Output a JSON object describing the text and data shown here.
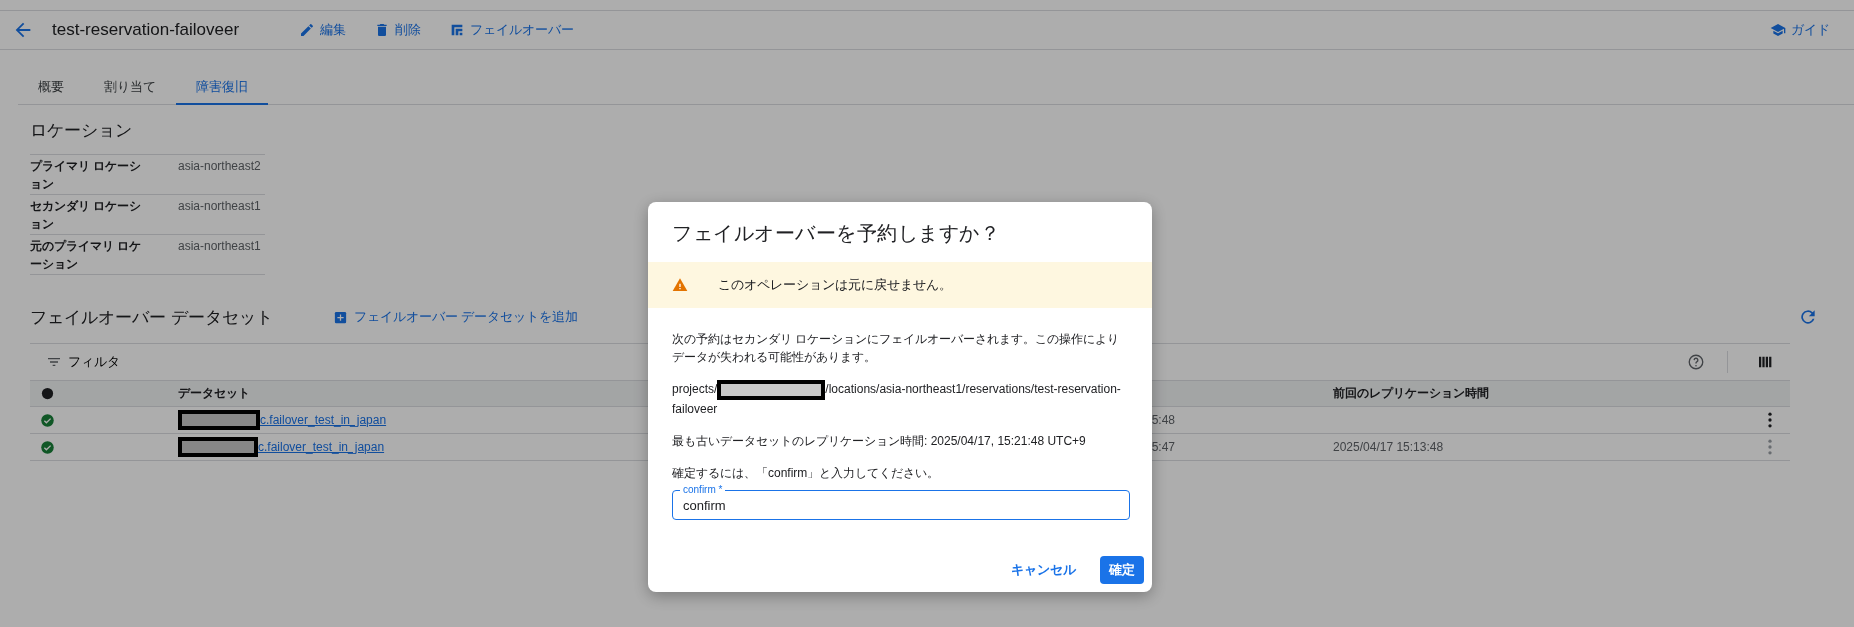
{
  "header": {
    "title": "test-reservation-failoveer",
    "actions": [
      {
        "kind": "edit",
        "label": "編集"
      },
      {
        "kind": "delete",
        "label": "削除"
      },
      {
        "kind": "failover",
        "label": "フェイルオーバー"
      }
    ],
    "guide": "ガイド"
  },
  "tabs": [
    {
      "label": "概要",
      "selected": false
    },
    {
      "label": "割り当て",
      "selected": false
    },
    {
      "label": "障害復旧",
      "selected": true
    }
  ],
  "location": {
    "heading": "ロケーション",
    "rows": [
      {
        "label": "プライマリ ロケーション",
        "value": "asia-northeast2"
      },
      {
        "label": "セカンダリ ロケーション",
        "value": "asia-northeast1"
      },
      {
        "label": "元のプライマリ ロケーション",
        "value": "asia-northeast1"
      }
    ]
  },
  "datasets": {
    "heading": "フェイルオーバー データセット",
    "add_button": "フェイルオーバー データセットを追加",
    "filter": "フィルタ",
    "columns": [
      "データセット",
      "前回のレプリケーション時間"
    ],
    "rows": [
      {
        "healthy": true,
        "dataset": "c.failover_test_in_japan",
        "column_3": "5:48",
        "last_replication": "",
        "menu_enabled": true
      },
      {
        "healthy": true,
        "dataset": "c.failover_test_in_japan",
        "column_3": "5:47",
        "last_replication": "2025/04/17 15:13:48",
        "menu_enabled": false
      }
    ]
  },
  "dialog": {
    "title": "フェイルオーバーを予約しますか？",
    "warning": "このオペレーションは元に戻せません。",
    "message": "次の予約はセカンダリ ロケーションにフェイルオーバーされます。この操作によりデータが失われる可能性があります。",
    "path_prefix": "projects/",
    "path_suffix": "/locations/asia-northeast1/reservations/test-reservation-failoveer",
    "oldest": "最も古いデータセットのレプリケーション時間: 2025/04/17, 15:21:48 UTC+9",
    "prompt": "確定するには、「confirm」と入力してください。",
    "field": {
      "label": "confirm *",
      "value": "confirm"
    },
    "buttons": [
      {
        "kind": "text",
        "label": "キャンセル"
      },
      {
        "kind": "primary",
        "label": "確定"
      }
    ]
  }
}
